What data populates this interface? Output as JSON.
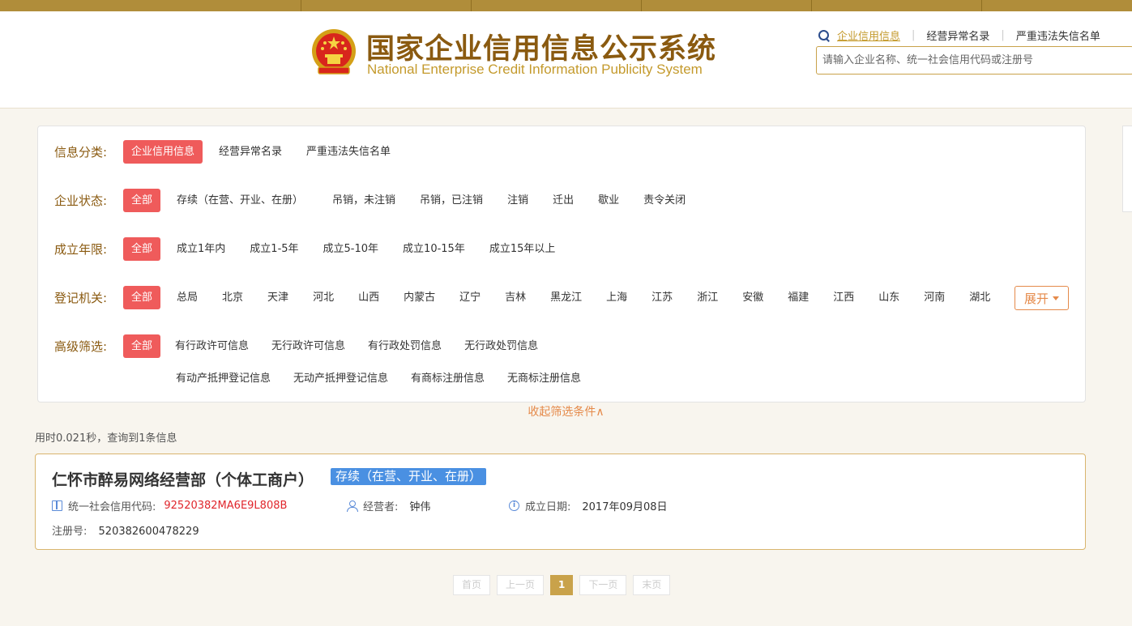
{
  "header": {
    "title_cn": "国家企业信用信息公示系统",
    "title_en": "National Enterprise Credit Information Publicity System",
    "nav": [
      "企业信用信息",
      "经营异常名录",
      "严重违法失信名单"
    ],
    "search_placeholder": "请输入企业名称、统一社会信用代码或注册号"
  },
  "filters": {
    "category": {
      "label": "信息分类:",
      "options": [
        "企业信用信息",
        "经营异常名录",
        "严重违法失信名单"
      ],
      "selected": "企业信用信息"
    },
    "status": {
      "label": "企业状态:",
      "options": [
        "全部",
        "存续（在营、开业、在册）",
        "吊销，未注销",
        "吊销，已注销",
        "注销",
        "迁出",
        "歇业",
        "责令关闭"
      ],
      "selected": "全部"
    },
    "years": {
      "label": "成立年限:",
      "options": [
        "全部",
        "成立1年内",
        "成立1-5年",
        "成立5-10年",
        "成立10-15年",
        "成立15年以上"
      ],
      "selected": "全部"
    },
    "authority": {
      "label": "登记机关:",
      "options": [
        "全部",
        "总局",
        "北京",
        "天津",
        "河北",
        "山西",
        "内蒙古",
        "辽宁",
        "吉林",
        "黑龙江",
        "上海",
        "江苏",
        "浙江",
        "安徽",
        "福建",
        "江西",
        "山东",
        "河南",
        "湖北"
      ],
      "selected": "全部"
    },
    "advanced": {
      "label": "高级筛选:",
      "options_row1": [
        "全部",
        "有行政许可信息",
        "无行政许可信息",
        "有行政处罚信息",
        "无行政处罚信息"
      ],
      "options_row2": [
        "有动产抵押登记信息",
        "无动产抵押登记信息",
        "有商标注册信息",
        "无商标注册信息"
      ],
      "selected": "全部"
    },
    "expand_label": "展开",
    "collapse_label": "收起筛选条件∧"
  },
  "results": {
    "meta": "用时0.021秒，查询到1条信息",
    "items": [
      {
        "name": "仁怀市醉易网络经营部（个体工商户）",
        "status": "存续（在营、开业、在册）",
        "credit_code_label": "统一社会信用代码:",
        "credit_code": "92520382MA6E9L808B",
        "operator_label": "经营者:",
        "operator": "钟伟",
        "founded_label": "成立日期:",
        "founded": "2017年09月08日",
        "reg_label": "注册号:",
        "reg_no": "520382600478229"
      }
    ]
  },
  "pager": {
    "first": "首页",
    "prev": "上一页",
    "current": "1",
    "next": "下一页",
    "last": "末页"
  },
  "colors": {
    "brand": "#8a5a10",
    "accent": "#c49a2c",
    "selected": "#ef5b5b",
    "status": "#4a90e2",
    "code_red": "#e0262c"
  }
}
